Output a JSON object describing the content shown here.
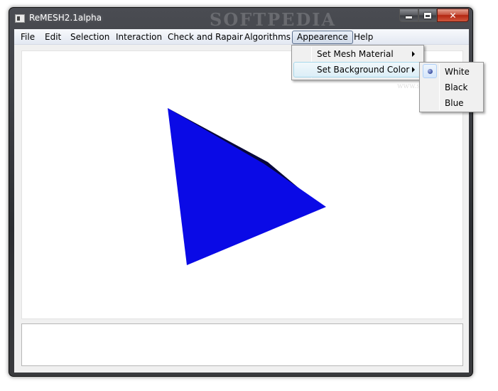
{
  "window": {
    "title": "ReMESH2.1alpha",
    "watermark": "SOFTPEDIA"
  },
  "menubar": {
    "items": [
      {
        "label": "File"
      },
      {
        "label": "Edit"
      },
      {
        "label": "Selection"
      },
      {
        "label": "Interaction"
      },
      {
        "label": "Check and Rapair"
      },
      {
        "label": "Algorithms"
      },
      {
        "label": "Appearence",
        "open": true
      },
      {
        "label": "Help"
      }
    ]
  },
  "appearence_menu": {
    "items": [
      {
        "label": "Set Mesh Material",
        "has_submenu": true
      },
      {
        "label": "Set Background Color",
        "has_submenu": true,
        "highlighted": true
      }
    ]
  },
  "background_color_submenu": {
    "items": [
      {
        "label": "White",
        "selected": true
      },
      {
        "label": "Black"
      },
      {
        "label": "Blue"
      }
    ]
  },
  "viewport": {
    "background": "#ffffff",
    "mesh_color": "#0a0ae6",
    "mesh_shadow_color": "#08083a"
  },
  "colors": {
    "close_button": "#c8402b",
    "menu_highlight_border": "#a8d8eb",
    "window_frame": "#2b2d31"
  }
}
